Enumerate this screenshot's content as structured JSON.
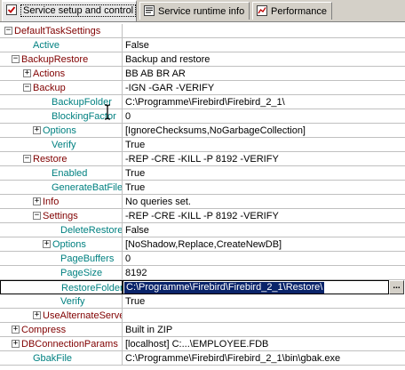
{
  "tabs": [
    {
      "label": "Service setup and control",
      "icon": "checkbox-icon",
      "active": true
    },
    {
      "label": "Service runtime info",
      "icon": "monitor-icon",
      "active": false
    },
    {
      "label": "Performance",
      "icon": "chart-icon",
      "active": false
    }
  ],
  "rows": [
    {
      "name": "DefaultTaskSettings",
      "value": "",
      "color": "red",
      "expander": "−",
      "indent": 0
    },
    {
      "name": "Active",
      "value": "False",
      "color": "teal",
      "expander": "",
      "indent": 1
    },
    {
      "name": "BackupRestore",
      "value": "Backup and restore",
      "color": "red",
      "expander": "−",
      "indent": 1
    },
    {
      "name": "Actions",
      "value": "BB AB BR AR",
      "color": "red",
      "expander": "+",
      "indent": 2
    },
    {
      "name": "Backup",
      "value": " -IGN -GAR -VERIFY",
      "color": "red",
      "expander": "−",
      "indent": 2
    },
    {
      "name": "BackupFolder",
      "value": "C:\\Programme\\Firebird\\Firebird_2_1\\",
      "color": "teal",
      "expander": "",
      "indent": 3
    },
    {
      "name": "BlockingFactor",
      "value": "0",
      "color": "teal",
      "expander": "",
      "indent": 3
    },
    {
      "name": "Options",
      "value": "[IgnoreChecksums,NoGarbageCollection]",
      "color": "teal",
      "expander": "+",
      "indent": 3
    },
    {
      "name": "Verify",
      "value": "True",
      "color": "teal",
      "expander": "",
      "indent": 3
    },
    {
      "name": "Restore",
      "value": " -REP -CRE -KILL -P 8192 -VERIFY",
      "color": "red",
      "expander": "−",
      "indent": 2
    },
    {
      "name": "Enabled",
      "value": "True",
      "color": "teal",
      "expander": "",
      "indent": 3
    },
    {
      "name": "GenerateBatFile",
      "value": "True",
      "color": "teal",
      "expander": "",
      "indent": 3
    },
    {
      "name": "Info",
      "value": "No queries set.",
      "color": "red",
      "expander": "+",
      "indent": 3
    },
    {
      "name": "Settings",
      "value": " -REP -CRE -KILL -P 8192 -VERIFY",
      "color": "red",
      "expander": "−",
      "indent": 3
    },
    {
      "name": "DeleteRestored",
      "value": "False",
      "color": "teal",
      "expander": "",
      "indent": 4
    },
    {
      "name": "Options",
      "value": "[NoShadow,Replace,CreateNewDB]",
      "color": "teal",
      "expander": "+",
      "indent": 4
    },
    {
      "name": "PageBuffers",
      "value": "0",
      "color": "teal",
      "expander": "",
      "indent": 4
    },
    {
      "name": "PageSize",
      "value": "8192",
      "color": "teal",
      "expander": "",
      "indent": 4
    },
    {
      "name": "RestoreFolder",
      "value": "C:\\Programme\\Firebird\\Firebird_2_1\\Restore\\",
      "color": "teal",
      "expander": "",
      "indent": 4,
      "selected": true
    },
    {
      "name": "Verify",
      "value": "True",
      "color": "teal",
      "expander": "",
      "indent": 4
    },
    {
      "name": "UseAlternateServe",
      "value": "",
      "color": "red",
      "expander": "+",
      "indent": 3
    },
    {
      "name": "Compress",
      "value": "Built in ZIP",
      "color": "red",
      "expander": "+",
      "indent": 1
    },
    {
      "name": "DBConnectionParams",
      "value": "[localhost] C:...\\EMPLOYEE.FDB",
      "color": "red",
      "expander": "+",
      "indent": 1
    },
    {
      "name": "GbakFile",
      "value": "C:\\Programme\\Firebird\\Firebird_2_1\\bin\\gbak.exe",
      "color": "teal",
      "expander": "",
      "indent": 1
    }
  ],
  "ellipsis_label": "...",
  "colors": {
    "red": "#800000",
    "teal": "#008080",
    "selection": "#0a246a"
  }
}
